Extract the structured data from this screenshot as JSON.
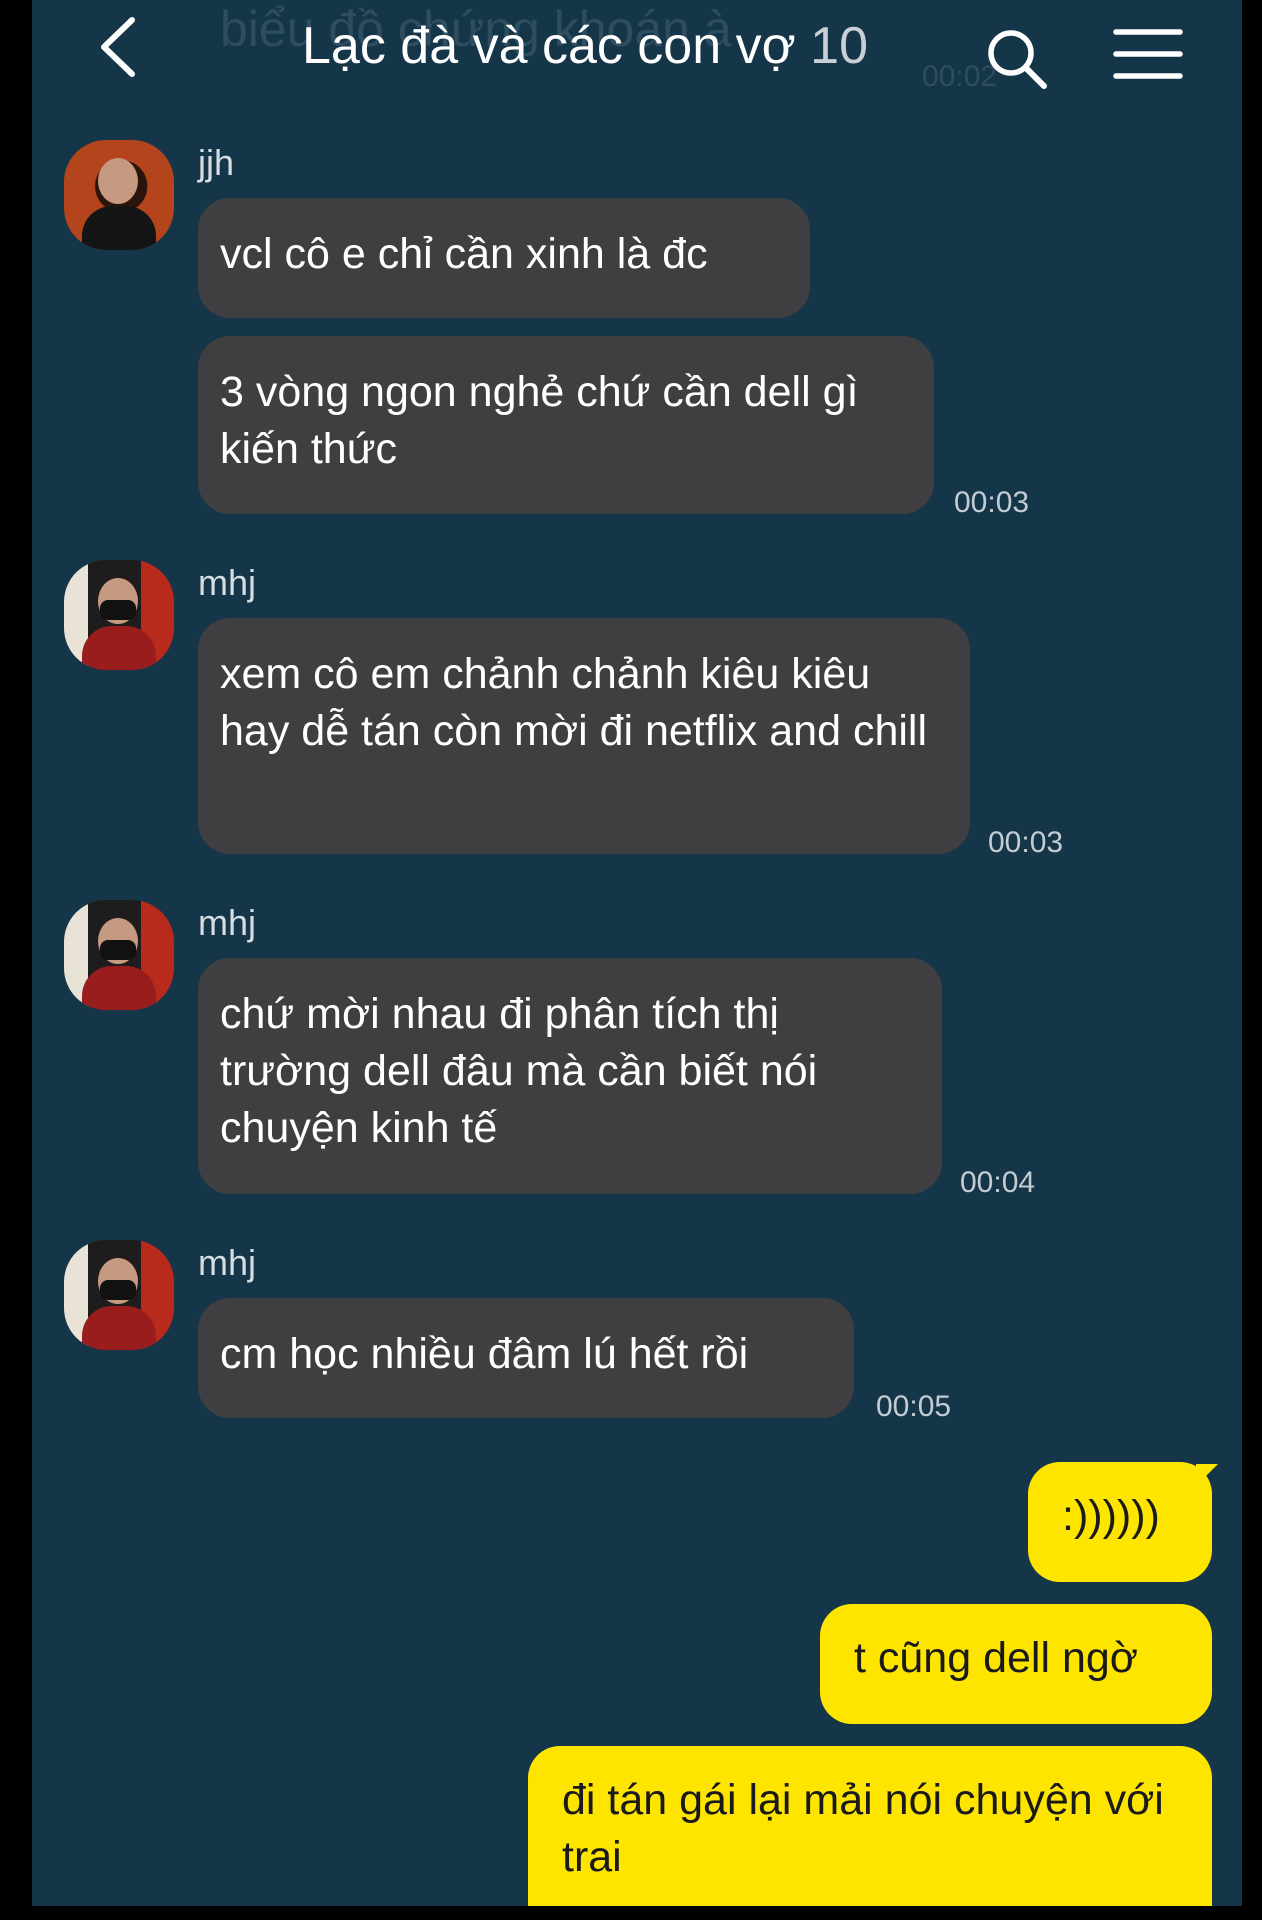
{
  "header": {
    "title": "Lạc đà và các con vợ",
    "member_count": "10",
    "ghost_text": "biểu đồ chứng khoán à",
    "ghost_time": "00:02"
  },
  "messages": [
    {
      "sender": "jjh",
      "text": "vcl cô e chỉ cần xinh là đc"
    },
    {
      "text": "3 vòng ngon nghẻ chứ cần dell gì kiến thức",
      "time": "00:03"
    },
    {
      "sender": "mhj",
      "text": "xem cô em chảnh chảnh kiêu kiêu hay dễ tán còn mời đi netflix and chill",
      "time": "00:03"
    },
    {
      "sender": "mhj",
      "text": "chứ mời nhau đi phân tích thị trường dell đâu mà cần biết nói chuyện kinh tế",
      "time": "00:04"
    },
    {
      "sender": "mhj",
      "text": "cm học nhiều đâm lú hết rồi",
      "time": "00:05"
    }
  ],
  "my_messages": [
    {
      "text": ":))))))"
    },
    {
      "text": "t cũng dell ngờ"
    },
    {
      "text": "đi tán gái lại mải nói chuyện với trai"
    }
  ],
  "colors": {
    "background": "#153649",
    "incoming_bubble": "#3f3f42",
    "outgoing_bubble": "#fee500"
  },
  "icons": [
    "back-arrow-icon",
    "search-icon",
    "menu-icon"
  ]
}
